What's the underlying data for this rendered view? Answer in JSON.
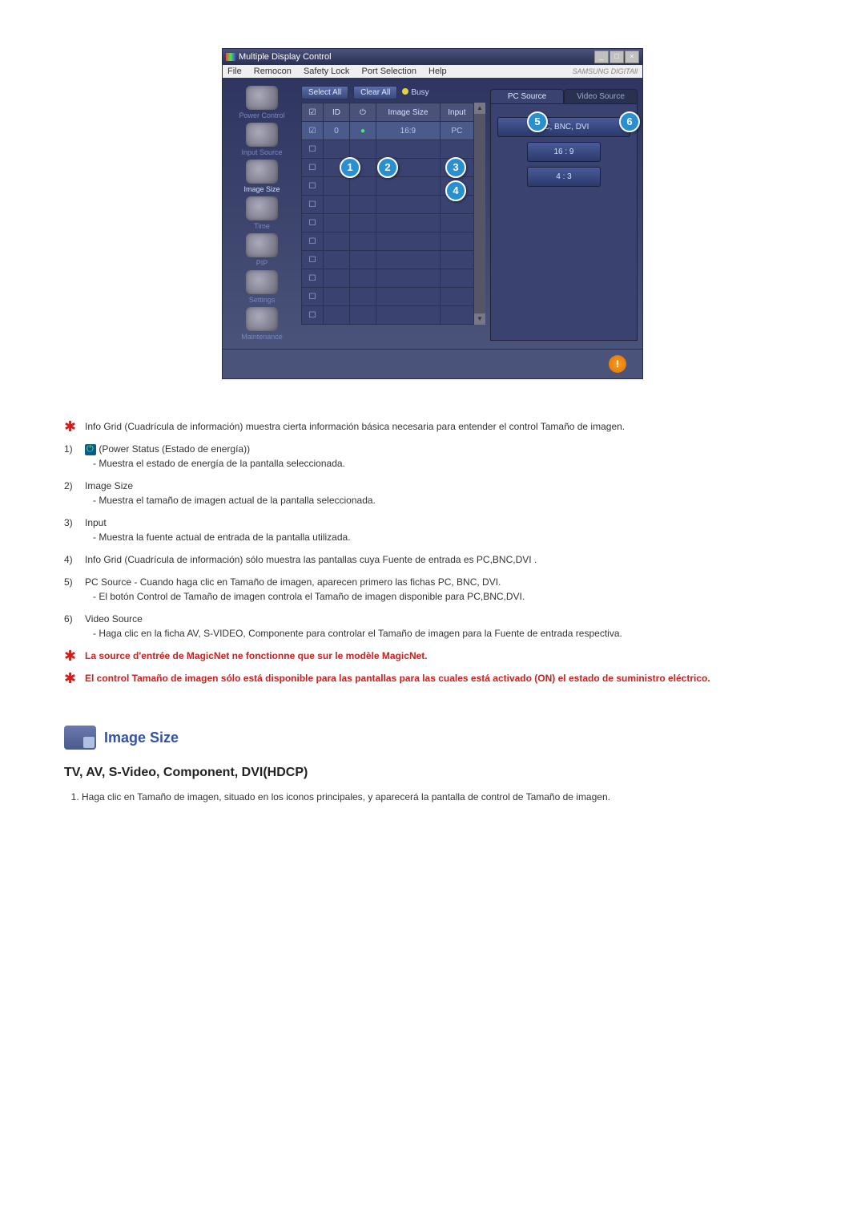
{
  "app": {
    "title": "Multiple Display Control",
    "brand": "SAMSUNG DIGITAll"
  },
  "menubar": {
    "file": "File",
    "remocon": "Remocon",
    "safety_lock": "Safety Lock",
    "port_selection": "Port Selection",
    "help": "Help"
  },
  "sidebar": {
    "items": [
      {
        "label": "Power Control"
      },
      {
        "label": "Input Source"
      },
      {
        "label": "Image Size"
      },
      {
        "label": "Time"
      },
      {
        "label": "PIP"
      },
      {
        "label": "Settings"
      },
      {
        "label": "Maintenance"
      }
    ]
  },
  "toolbar": {
    "select_all": "Select All",
    "clear_all": "Clear All",
    "busy": "Busy"
  },
  "grid": {
    "headers": {
      "check": "☑",
      "id": "ID",
      "power": "⏻",
      "image_size": "Image Size",
      "input": "Input"
    },
    "row0": {
      "id": "0",
      "power": "●",
      "image_size": "16:9",
      "input": "PC"
    }
  },
  "tabs": {
    "pc_source": "PC Source",
    "video_source": "Video Source"
  },
  "panel_buttons": {
    "pc_bnc_dvi": "PC, BNC, DVI",
    "ratio_16_9": "16 : 9",
    "ratio_4_3": "4 : 3"
  },
  "callouts": {
    "c1": "1",
    "c2": "2",
    "c3": "3",
    "c4": "4",
    "c5": "5",
    "c6": "6"
  },
  "alert": "!",
  "text": {
    "intro": "Info Grid (Cuadrícula de información) muestra cierta información básica necesaria para entender el control Tamaño de imagen.",
    "l1_head": " (Power Status (Estado de energía))",
    "l1_sub": "- Muestra el estado de energía de la pantalla seleccionada.",
    "l2_head": "Image Size",
    "l2_sub": "- Muestra el tamaño de imagen actual de la pantalla seleccionada.",
    "l3_head": "Input",
    "l3_sub": "- Muestra la fuente actual de entrada de la pantalla utilizada.",
    "l4": "Info Grid (Cuadrícula de información) sólo muestra las pantallas cuya Fuente de entrada es PC,BNC,DVI .",
    "l5_head": "PC Source - Cuando haga clic en Tamaño de imagen, aparecen primero las fichas PC, BNC, DVI.",
    "l5_sub": "- El botón Control de Tamaño de imagen controla el Tamaño de imagen disponible para PC,BNC,DVI.",
    "l6_head": "Video Source",
    "l6_sub": "- Haga clic en la ficha AV, S-VIDEO, Componente para controlar el Tamaño de imagen para la Fuente de entrada respectiva.",
    "note1": "La source d'entrée de MagicNet ne fonctionne que sur le modèle MagicNet.",
    "note2": "El control Tamaño de imagen sólo está disponible para las pantallas para las cuales está activado (ON) el estado de suministro eléctrico.",
    "section_title": "Image Size",
    "subheading": "TV, AV, S-Video, Component, DVI(HDCP)",
    "instr1": "Haga clic en Tamaño de imagen, situado en los iconos principales, y aparecerá la pantalla de control de Tamaño de imagen."
  },
  "nums": {
    "n1": "1)",
    "n2": "2)",
    "n3": "3)",
    "n4": "4)",
    "n5": "5)",
    "n6": "6)",
    "o1": "1."
  }
}
